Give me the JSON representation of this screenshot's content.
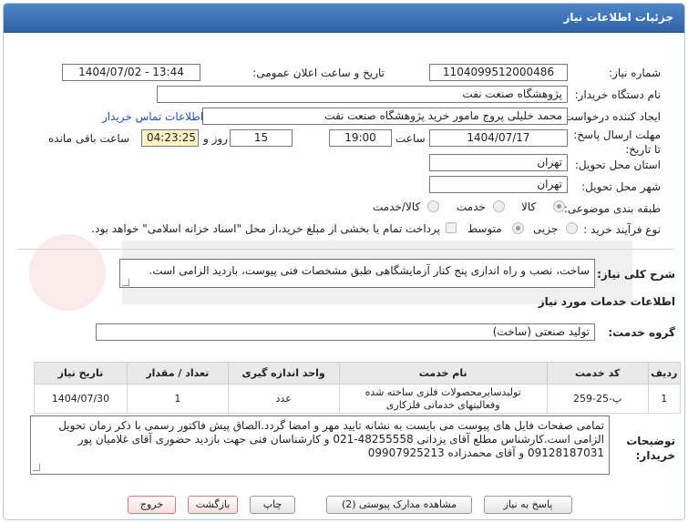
{
  "header": {
    "title": "جزئیات اطلاعات نیاز"
  },
  "fields": {
    "need_number_label": "شماره نیاز:",
    "need_number": "1104099512000486",
    "announce_datetime_label": "تاریخ و ساعت اعلان عمومی:",
    "announce_datetime": "1404/07/02 - 13:44",
    "buyer_org_label": "نام دستگاه خریدار:",
    "buyer_org": "پژوهشگاه صنعت نفت",
    "requester_label": "ایجاد کننده درخواست:",
    "requester": "محمد خلیلی پروج مامور خرید پژوهشگاه صنعت نفت",
    "buyer_contact_link": "اطلاعات تماس خریدار",
    "deadline_label": "مهلت ارسال پاسخ: تا تاریخ:",
    "deadline_date": "1404/07/17",
    "hour_label": "ساعت",
    "deadline_time": "19:00",
    "days_value": "15",
    "days_label": "روز و",
    "remaining_time": "04:23:25",
    "remaining_label": "ساعت باقی مانده",
    "province_label": "استان محل تحویل:",
    "province": "تهران",
    "city_label": "شهر محل تحویل:",
    "city": "تهران",
    "category_label": "طبقه بندی موضوعی:",
    "category_options": [
      "کالا",
      "خدمت",
      "کالا/خدمت"
    ],
    "process_label": "نوع فرآیند خرید :",
    "process_options": [
      "جزیی",
      "متوسط"
    ],
    "payment_note": "پرداخت تمام یا بخشی از مبلغ خرید،از محل \"اسناد خزانه اسلامی\" خواهد بود."
  },
  "description": {
    "label": "شرح کلی نیاز:",
    "text": "ساخت، نصب و راه اندازی پنج کنار آزمایشگاهی طبق مشخصات فنی پیوست، بازدید الزامی است."
  },
  "services": {
    "section_title": "اطلاعات خدمات مورد نیاز",
    "group_label": "گروه خدمت:",
    "group_value": "تولید صنعتی (ساخت)",
    "columns": [
      "ردیف",
      "کد خدمت",
      "نام خدمت",
      "واحد اندازه گیری",
      "تعداد / مقدار",
      "تاریخ نیاز"
    ],
    "rows": [
      {
        "row": "1",
        "code": "پ-25-259",
        "name": "تولیدسایرمحصولات فلزی ساخته شده وفعالیتهای خدماتی فلزکاری",
        "unit": "عدد",
        "qty": "1",
        "date": "1404/07/30"
      }
    ]
  },
  "buyer_notes": {
    "label": "توضیحات خریدار:",
    "line1": "تمامی صفحات فایل های پیوست می بایست به نشانه تایید مهر و امضا گردد.الصاق پیش فاکتور رسمی با ذکر زمان تحویل",
    "line2": "الزامی است.کارشناس مطلع آقای یزدانی 48255558-021 و کارشناسان فنی جهت بازدید حضوری آقای غلامیان پور",
    "line3": "09128187031 و آقای محمدزاده 09907925213"
  },
  "buttons": {
    "reply": "پاسخ به نیاز",
    "attachments": "مشاهده مدارک پیوستی (2)",
    "print": "چاپ",
    "back": "بازگشت",
    "exit": "خروج"
  },
  "colors": {
    "header": "#3a6fb4",
    "link": "#1f4fbf",
    "remaining_bg": "#fff5c6"
  }
}
